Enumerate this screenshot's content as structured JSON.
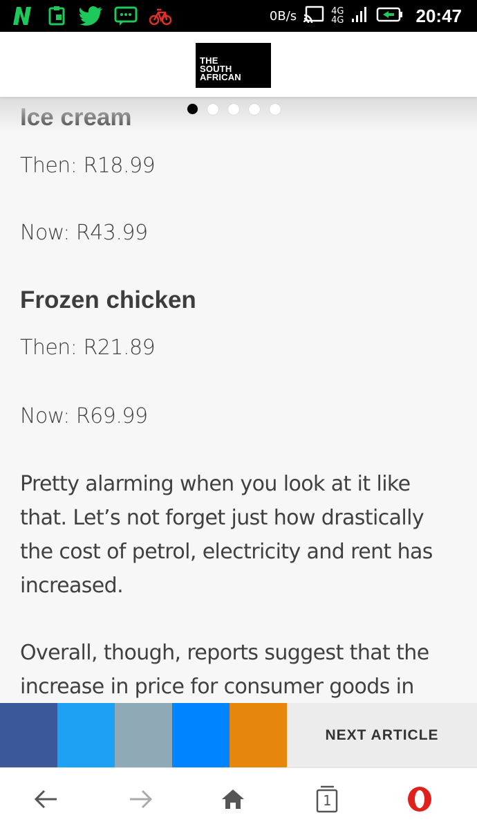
{
  "status_bar": {
    "net_speed": "0B/s",
    "network_type_top": "4G",
    "network_type_bottom": "4G",
    "time": "20:47",
    "icons": [
      "n-app-icon",
      "clipboard-icon",
      "twitter-bird-icon",
      "chat-bubble-icon",
      "bicycle-icon",
      "cast-icon",
      "signal-icon",
      "battery-icon"
    ]
  },
  "header": {
    "logo_line1": "THE",
    "logo_line2": "SOUTH",
    "logo_line3": "AFRICAN"
  },
  "carousel": {
    "dot_count": 5,
    "active_index": 0
  },
  "article": {
    "item1_title": "Ice cream",
    "item1_then": "Then: R18.99",
    "item1_now": "Now: R43.99",
    "item2_title": "Frozen chicken",
    "item2_then": "Then: R21.89",
    "item2_now": "Now: R69.99",
    "paragraph1": "Pretty alarming when you look at it like that. Let’s not forget just how drastically the cost of petrol, electricity and rent has increased.",
    "paragraph2": "Overall, though, reports suggest that the increase in price for consumer goods in"
  },
  "share_bar": {
    "colors": [
      "#3b5998",
      "#1da1f2",
      "#8fa9b7",
      "#0084ff",
      "#e6860b"
    ],
    "next_label": "NEXT ARTICLE"
  },
  "bottom_nav": {
    "tabs_count": "1",
    "accent": "#e0201b"
  }
}
